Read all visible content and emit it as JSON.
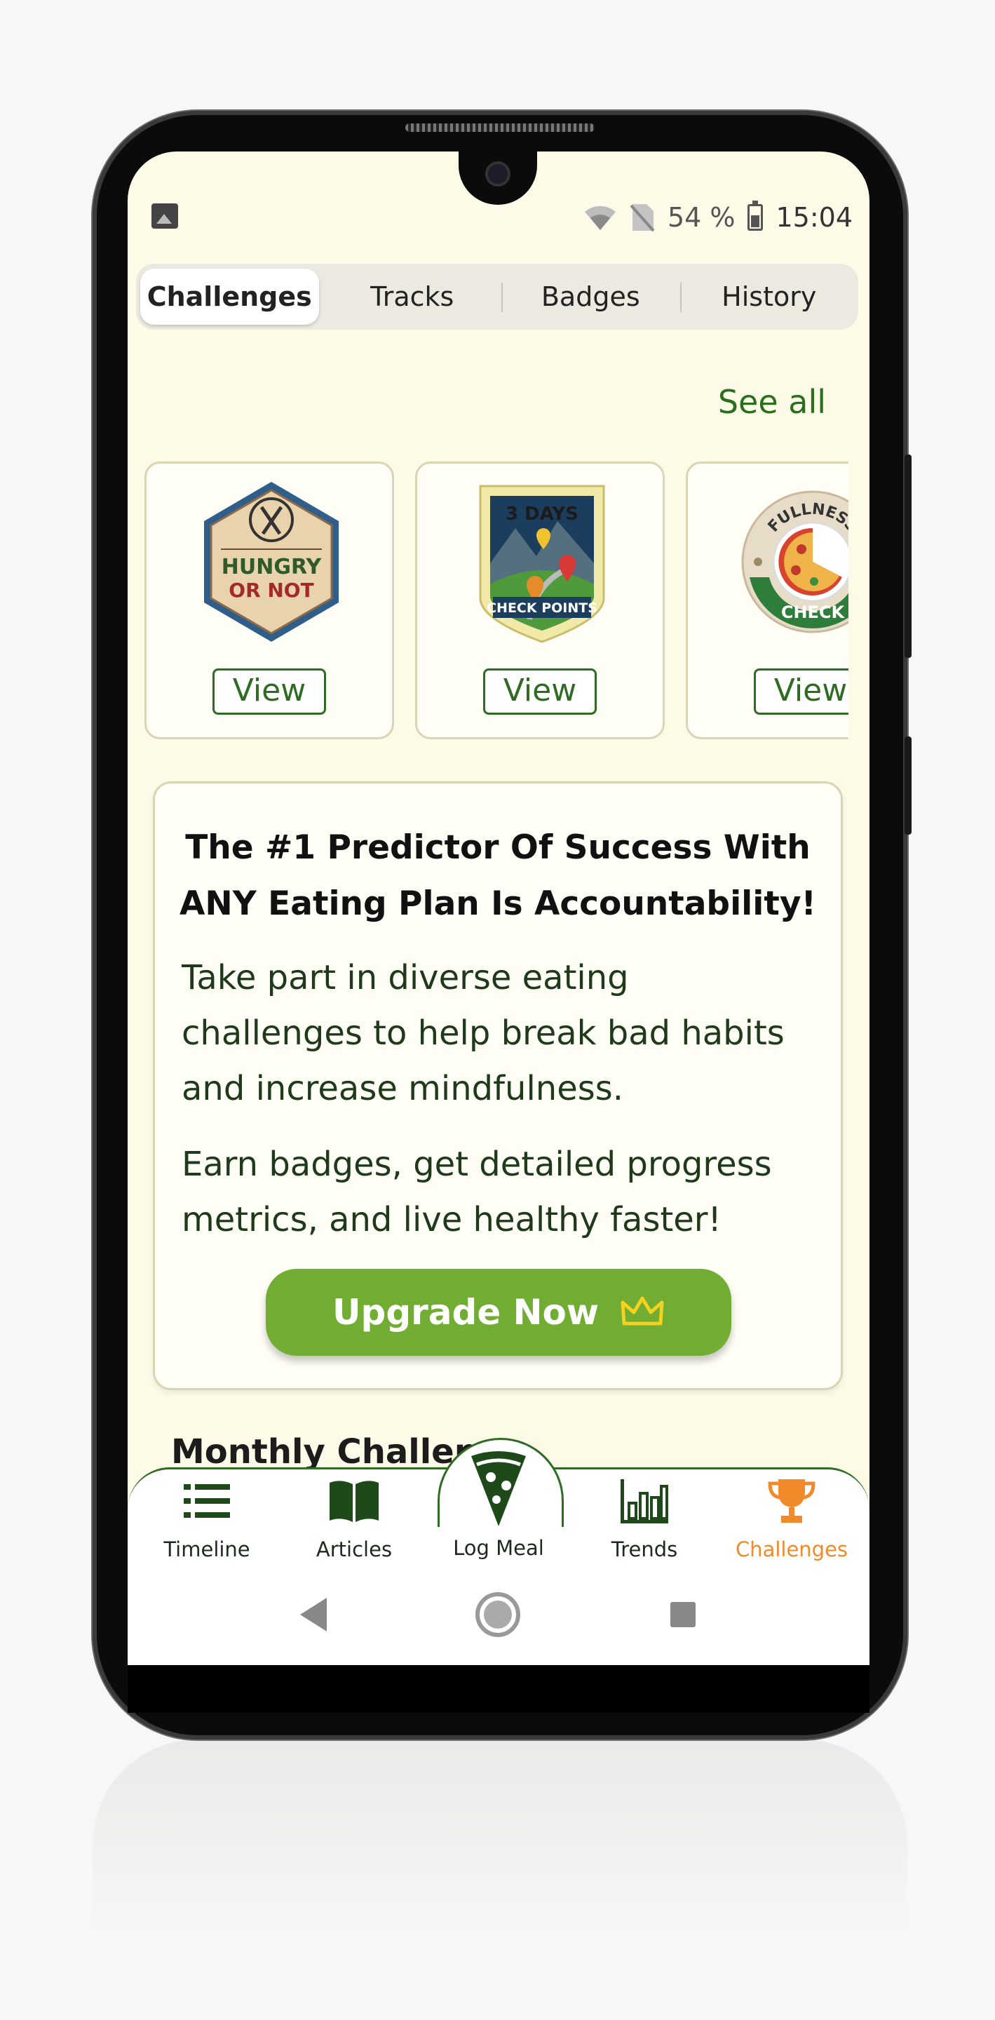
{
  "status_bar": {
    "battery": "54 %",
    "time": "15:04",
    "icons": [
      "image-icon",
      "wifi-icon",
      "no-sim-icon",
      "battery-icon"
    ]
  },
  "tabs": [
    {
      "label": "Challenges",
      "active": true
    },
    {
      "label": "Tracks",
      "active": false
    },
    {
      "label": "Badges",
      "active": false
    },
    {
      "label": "History",
      "active": false
    }
  ],
  "see_all": "See all",
  "challenges": [
    {
      "badge_line1": "HUNGRY",
      "badge_line2": "OR NOT",
      "button": "View"
    },
    {
      "badge_line1": "3 DAYS",
      "badge_line2": "CHECK POINTS",
      "button": "View"
    },
    {
      "badge_line1": "FULLNESS",
      "badge_line2": "CHECK",
      "button": "View"
    }
  ],
  "promo": {
    "title_line1": "The #1 Predictor Of Success With",
    "title_line2": "ANY Eating Plan Is Accountability!",
    "text1": "Take part in diverse eating challenges to help break bad habits and increase mindfulness.",
    "text2": "Earn badges, get detailed progress metrics, and live healthy faster!",
    "button": "Upgrade Now"
  },
  "monthly_heading": "Monthly Challen",
  "nav": [
    {
      "label": "Timeline",
      "icon": "list-icon"
    },
    {
      "label": "Articles",
      "icon": "book-icon"
    },
    {
      "label": "Log Meal",
      "icon": "pizza-icon"
    },
    {
      "label": "Trends",
      "icon": "bar-chart-icon"
    },
    {
      "label": "Challenges",
      "icon": "trophy-icon",
      "active": true
    }
  ],
  "colors": {
    "brand_green": "#2f6b23",
    "upgrade_green": "#72ad33",
    "active_orange": "#f08a2a",
    "screen_bg": "#fdfbe8"
  }
}
